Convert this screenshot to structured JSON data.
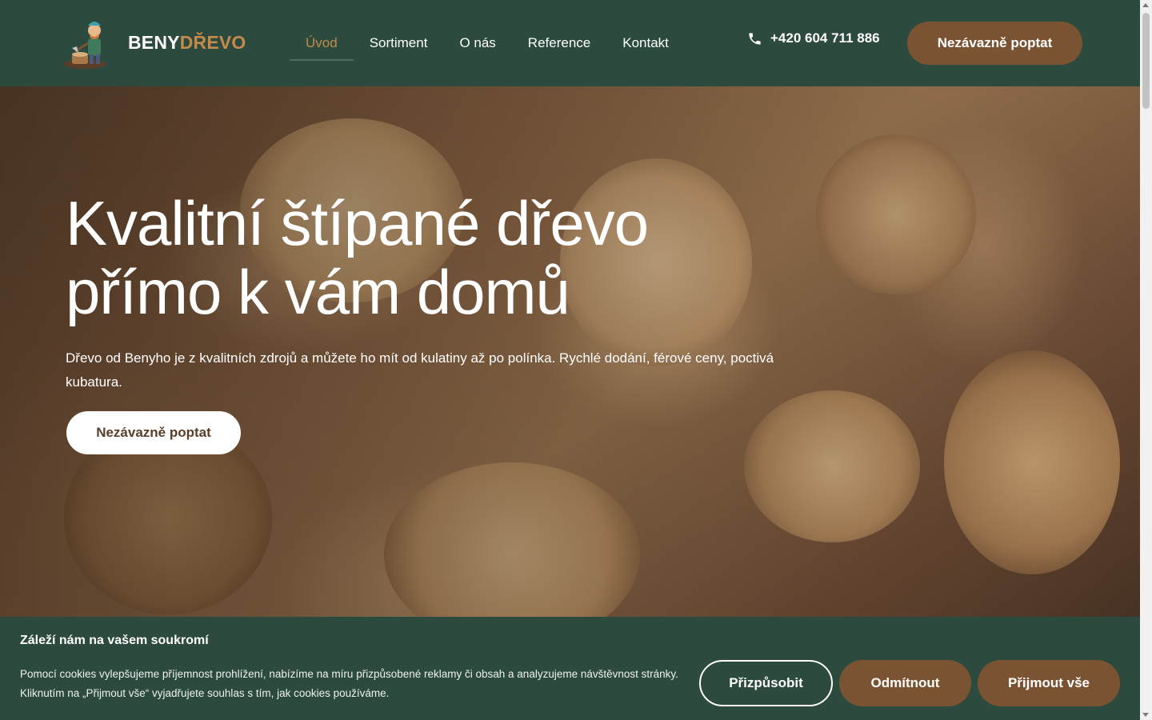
{
  "brand": {
    "part1": "BENY",
    "part2": "DŘEVO"
  },
  "nav": {
    "items": [
      {
        "label": "Úvod",
        "active": true
      },
      {
        "label": "Sortiment",
        "active": false
      },
      {
        "label": "O nás",
        "active": false
      },
      {
        "label": "Reference",
        "active": false
      },
      {
        "label": "Kontakt",
        "active": false
      }
    ]
  },
  "header": {
    "phone": "+420 604 711 886",
    "cta_label": "Nezávazně poptat"
  },
  "hero": {
    "title_line1": "Kvalitní štípané dřevo",
    "title_line2": "přímo k vám domů",
    "subtitle": "Dřevo od Benyho je z kvalitních zdrojů a můžete ho mít od kulatiny až po polínka. Rychlé dodání, férové ceny, poctivá kubatura.",
    "cta_label": "Nezávazně poptat"
  },
  "cookie": {
    "title": "Záleží nám na vašem soukromí",
    "text": "Pomocí cookies vylepšujeme příjemnost prohlížení, nabízíme na míru přizpůsobené reklamy či obsah a analyzujeme návštěvnost stránky. Kliknutím na „Přijmout vše“ vyjadřujete souhlas s tím, jak cookies používáme.",
    "customize_label": "Přizpůsobit",
    "decline_label": "Odmítnout",
    "accept_label": "Přijmout vše"
  },
  "colors": {
    "primary_green": "#2c4a3d",
    "accent_brown": "#7a5432",
    "accent_gold": "#c48a4c"
  },
  "icons": {
    "phone": "phone-icon",
    "logo": "lumberjack-logo-icon"
  }
}
